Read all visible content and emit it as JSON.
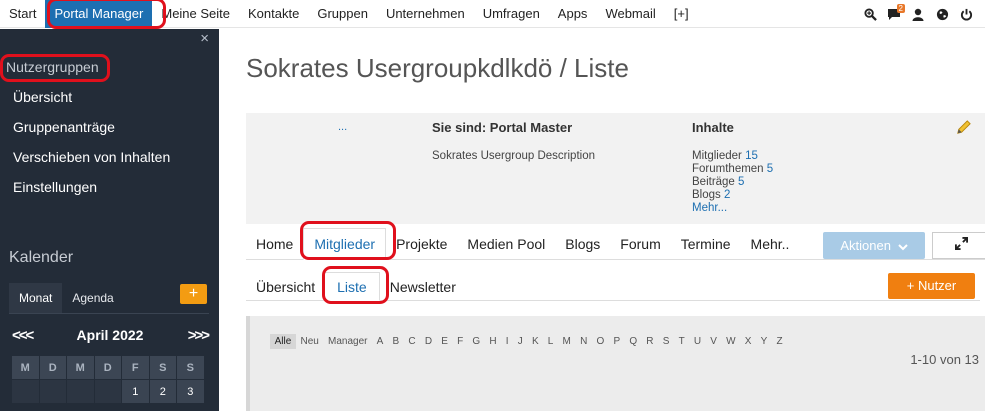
{
  "topnav": {
    "items": [
      "Start",
      "Portal Manager",
      "Meine Seite",
      "Kontakte",
      "Gruppen",
      "Unternehmen",
      "Umfragen",
      "Apps",
      "Webmail",
      "[+]"
    ],
    "active_index": 1,
    "notification_count": "2",
    "icons": [
      "search-zoom-icon",
      "chat-icon",
      "user-icon",
      "globe-icon",
      "power-icon"
    ]
  },
  "sidebar": {
    "close": "×",
    "title": "Nutzergruppen",
    "links": [
      "Übersicht",
      "Gruppenanträge",
      "Verschieben von Inhalten",
      "Einstellungen"
    ],
    "calendar": {
      "title": "Kalender",
      "tabs": [
        "Monat",
        "Agenda"
      ],
      "add": "+",
      "prev_nav": "<<<",
      "next_nav": ">>>",
      "month": "April 2022",
      "weekdays": [
        "M",
        "D",
        "M",
        "D",
        "F",
        "S",
        "S"
      ],
      "first_row": [
        "",
        "",
        "",
        "",
        "1",
        "2",
        "3"
      ]
    }
  },
  "main": {
    "title": "Sokrates Usergroupkdlkdö / Liste",
    "info": {
      "dots": "...",
      "you_are": "Sie sind: Portal Master",
      "description": "Sokrates Usergroup Description",
      "contents_title": "Inhalte",
      "stats": [
        {
          "label": "Mitglieder",
          "value": "15"
        },
        {
          "label": "Forumthemen",
          "value": "5"
        },
        {
          "label": "Beiträge",
          "value": "5"
        },
        {
          "label": "Blogs",
          "value": "2"
        }
      ],
      "more": "Mehr..."
    },
    "tabs": [
      "Home",
      "Mitglieder",
      "Projekte",
      "Medien Pool",
      "Blogs",
      "Forum",
      "Termine",
      "Mehr.."
    ],
    "tabs_active": 1,
    "actions_button": "Aktionen",
    "subtabs": [
      "Übersicht",
      "Liste",
      "Newsletter"
    ],
    "subtabs_active": 1,
    "add_user_button": "+ Nutzer",
    "letters": [
      "Alle",
      "Neu",
      "Manager",
      "A",
      "B",
      "C",
      "D",
      "E",
      "F",
      "G",
      "H",
      "I",
      "J",
      "K",
      "L",
      "M",
      "N",
      "O",
      "P",
      "Q",
      "R",
      "S",
      "T",
      "U",
      "V",
      "W",
      "X",
      "Y",
      "Z"
    ],
    "letters_active": 0,
    "pager": "1-10 von 13"
  },
  "colors": {
    "accent": "#1d6fb1",
    "sidebar_bg": "#232c38",
    "orange": "#f07f10",
    "highlight": "#e0101c"
  }
}
